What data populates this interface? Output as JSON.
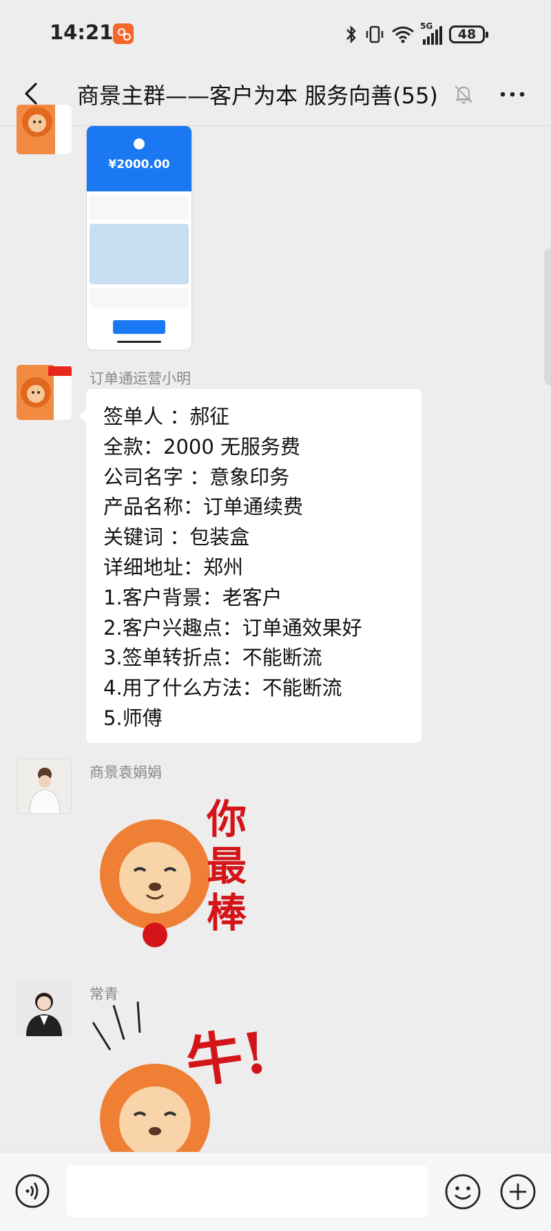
{
  "status_bar": {
    "time": "14:21",
    "network": "5G",
    "battery": "48"
  },
  "header": {
    "title": "商景主群——客户为本 服务向善(55)"
  },
  "messages": [
    {
      "type": "image",
      "sender": "",
      "screenshot_amount": "¥2000.00"
    },
    {
      "type": "text",
      "sender": "订单通运营小明",
      "lines": [
        "签单人 ：郝征",
        "全款：2000  无服务费",
        "公司名字 ：意象印务",
        "产品名称：订单通续费",
        "关键词 ：包装盒",
        "详细地址：郑州",
        "1.客户背景：老客户",
        "2.客户兴趣点：订单通效果好",
        "3.签单转折点：不能断流",
        "4.用了什么方法：不能断流",
        "5.师傅"
      ]
    },
    {
      "type": "sticker",
      "sender": "商景袁娟娟",
      "sticker_text": [
        "你",
        "最",
        "棒"
      ]
    },
    {
      "type": "sticker",
      "sender": "常青",
      "sticker_text": "牛!"
    }
  ],
  "input_bar": {
    "placeholder": ""
  },
  "colors": {
    "background": "#ededed",
    "bubble": "#ffffff",
    "sticker_red": "#d3151a",
    "lion_orange": "#f38a42"
  }
}
